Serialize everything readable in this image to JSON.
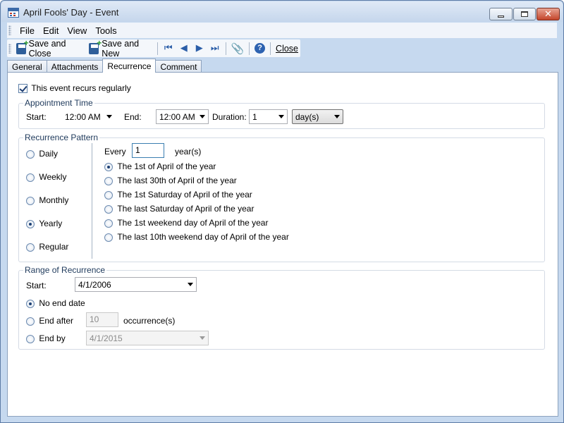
{
  "window": {
    "title": "April Fools' Day - Event"
  },
  "menu": [
    {
      "label": "File"
    },
    {
      "label": "Edit"
    },
    {
      "label": "View"
    },
    {
      "label": "Tools"
    }
  ],
  "toolbar": {
    "save_close": "Save and Close",
    "save_new": "Save and New",
    "close": "Close",
    "icons": [
      "save-close-icon",
      "save-new-icon",
      "first-record-icon",
      "previous-record-icon",
      "next-record-icon",
      "last-record-icon",
      "attach-icon",
      "help-icon"
    ]
  },
  "tabs": [
    {
      "label": "General",
      "active": false
    },
    {
      "label": "Attachments",
      "active": false
    },
    {
      "label": "Recurrence",
      "active": true
    },
    {
      "label": "Comment",
      "active": false
    }
  ],
  "recurs": {
    "label": "This event recurs regularly",
    "checked": true
  },
  "appointment": {
    "group_title": "Appointment Time",
    "start_label": "Start:",
    "start_value": "12:00 AM",
    "end_label": "End:",
    "end_value": "12:00 AM",
    "duration_label": "Duration:",
    "duration_value": "1",
    "unit_value": "day(s)"
  },
  "pattern": {
    "group_title": "Recurrence Pattern",
    "frequencies": [
      {
        "label": "Daily",
        "selected": false
      },
      {
        "label": "Weekly",
        "selected": false
      },
      {
        "label": "Monthly",
        "selected": false
      },
      {
        "label": "Yearly",
        "selected": true
      },
      {
        "label": "Regular",
        "selected": false
      }
    ],
    "every_label": "Every",
    "every_value": "1",
    "every_unit": "year(s)",
    "options": [
      {
        "label": "The 1st of April of the year",
        "selected": true
      },
      {
        "label": "The last 30th of April of the year",
        "selected": false
      },
      {
        "label": "The 1st Saturday of April of the year",
        "selected": false
      },
      {
        "label": "The last Saturday of April of the year",
        "selected": false
      },
      {
        "label": "The 1st weekend day of April of the year",
        "selected": false
      },
      {
        "label": "The last 10th weekend day of April of the year",
        "selected": false
      }
    ]
  },
  "range": {
    "group_title": "Range of Recurrence",
    "start_label": "Start:",
    "start_value": "4/1/2006",
    "no_end_label": "No end date",
    "end_after_label": "End after",
    "end_after_value": "10",
    "occurrences_label": "occurrence(s)",
    "end_by_label": "End by",
    "end_by_value": "4/1/2015",
    "selected": "no_end"
  }
}
